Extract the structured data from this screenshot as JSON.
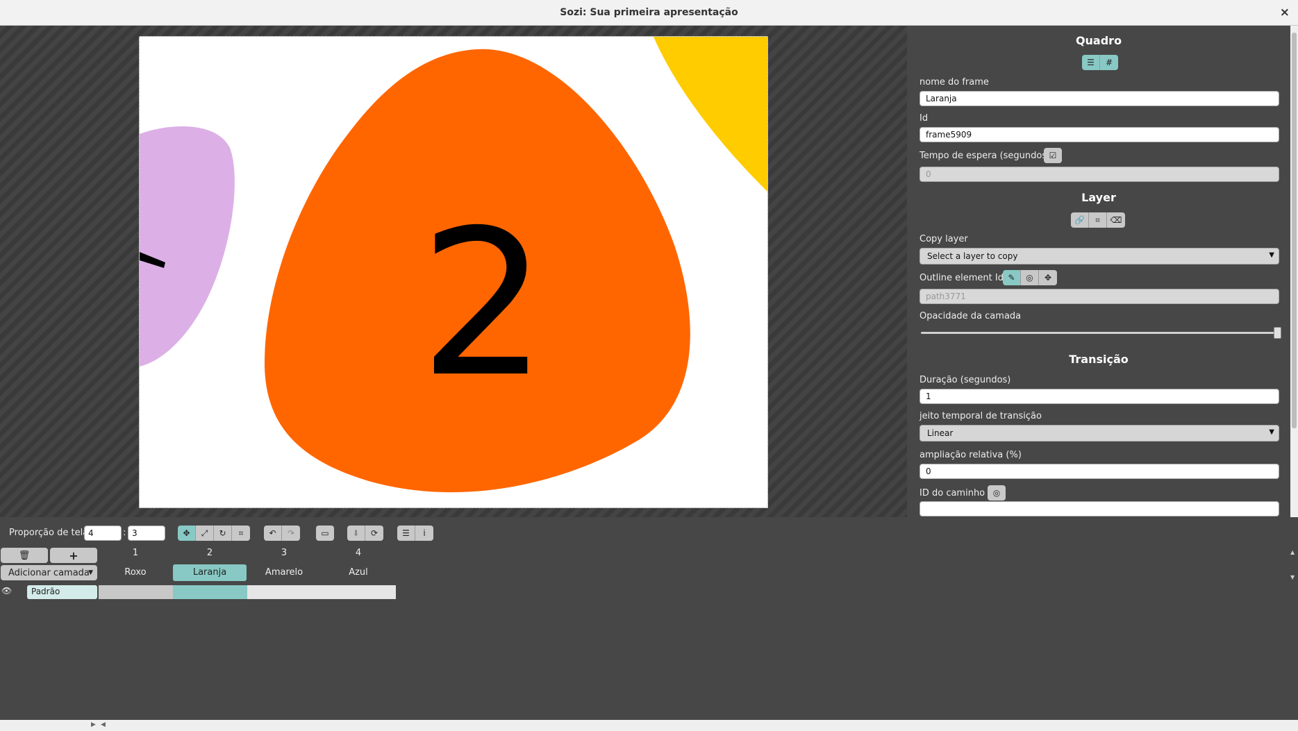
{
  "window": {
    "title": "Sozi: Sua primeira apresentação",
    "close": "×"
  },
  "slide": {
    "number": "2",
    "colors": {
      "orange": "#ff6600",
      "purple": "#dcb0e6",
      "yellow": "#ffcc00"
    }
  },
  "props": {
    "quadro": {
      "title": "Quadro",
      "frame_name_label": "nome do frame",
      "frame_name_value": "Laranja",
      "id_label": "Id",
      "id_value": "frame5909",
      "timeout_label": "Tempo de espera (segundos)",
      "timeout_value": "0"
    },
    "layer": {
      "title": "Layer",
      "copy_label": "Copy layer",
      "copy_select": "Select a layer to copy",
      "outline_label": "Outline element Id",
      "outline_value": "path3771",
      "opacity_label": "Opacidade da camada",
      "opacity_value": 1
    },
    "transicao": {
      "title": "Transição",
      "duration_label": "Duração (segundos)",
      "duration_value": "1",
      "timing_label": "jeito temporal de transição",
      "timing_value": "Linear",
      "zoom_label": "ampliação relativa (%)",
      "zoom_value": "0",
      "path_label": "ID do caminho",
      "path_value": ""
    }
  },
  "toolbar": {
    "aspect_label": "Proporção de tela",
    "aspect_w": "4",
    "aspect_sep": ":",
    "aspect_h": "3"
  },
  "timeline": {
    "add_layer": "Adicionar camada",
    "layer_name": "Padrão",
    "frames": [
      {
        "num": "1",
        "name": "Roxo"
      },
      {
        "num": "2",
        "name": "Laranja"
      },
      {
        "num": "3",
        "name": "Amarelo"
      },
      {
        "num": "4",
        "name": "Azul"
      }
    ],
    "accent": "#88c9c5"
  }
}
